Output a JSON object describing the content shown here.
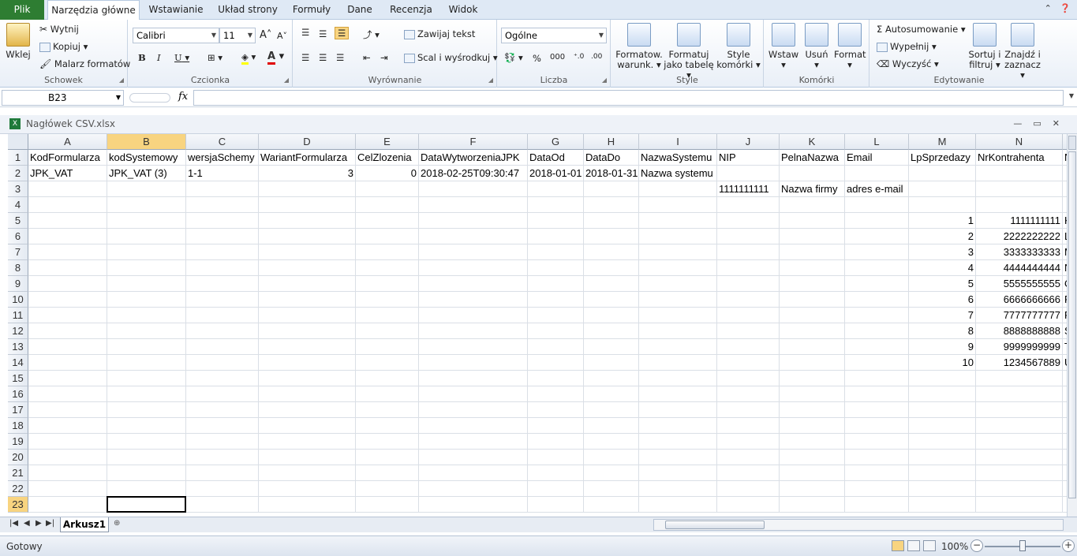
{
  "tabs": {
    "file": "Plik",
    "items": [
      "Narzędzia główne",
      "Wstawianie",
      "Układ strony",
      "Formuły",
      "Dane",
      "Recenzja",
      "Widok"
    ],
    "active_index": 0
  },
  "ribbon": {
    "clipboard": {
      "label": "Schowek",
      "paste": "Wklej",
      "cut": "Wytnij",
      "copy": "Kopiuj",
      "format_painter": "Malarz formatów"
    },
    "font": {
      "label": "Czcionka",
      "name": "Calibri",
      "size": "11",
      "bold": "B",
      "italic": "I",
      "underline": "U",
      "grow": "A",
      "shrink": "A"
    },
    "alignment": {
      "label": "Wyrównanie",
      "wrap": "Zawijaj tekst",
      "merge": "Scal i wyśrodkuj"
    },
    "number": {
      "label": "Liczba",
      "format": "Ogólne",
      "percent": "%",
      "thousands": "000"
    },
    "styles": {
      "label": "Style",
      "conditional": "Formatow. warunk.",
      "as_table": "Formatuj jako tabelę",
      "cell_styles": "Style komórki"
    },
    "cells": {
      "label": "Komórki",
      "insert": "Wstaw",
      "delete": "Usuń",
      "format": "Format"
    },
    "editing": {
      "label": "Edytowanie",
      "autosum": "Autosumowanie",
      "fill": "Wypełnij",
      "clear": "Wyczyść",
      "sort": "Sortuj i filtruj",
      "find": "Znajdź i zaznacz"
    }
  },
  "formula_bar": {
    "name_box": "B23",
    "fx": "fx",
    "content": ""
  },
  "workbook": {
    "title": "Nagłówek CSV.xlsx"
  },
  "grid": {
    "columns": [
      "A",
      "B",
      "C",
      "D",
      "E",
      "F",
      "G",
      "H",
      "I",
      "J",
      "K",
      "L",
      "M",
      "N"
    ],
    "rows": [
      "1",
      "2",
      "3",
      "4",
      "5",
      "6",
      "7",
      "8",
      "9",
      "10",
      "11",
      "12",
      "13",
      "14",
      "15",
      "16",
      "17",
      "18",
      "19",
      "20",
      "21",
      "22",
      "23"
    ],
    "selected_row": "23",
    "selected_column": "B",
    "cells": {
      "r1": [
        "KodFormularza",
        "kodSystemowy",
        "wersjaSchemy",
        "WariantFormularza",
        "CelZlozenia",
        "DataWytworzeniaJPK",
        "DataOd",
        "DataDo",
        "NazwaSystemu",
        "NIP",
        "PelnaNazwa",
        "Email",
        "LpSprzedazy",
        "NrKontrahenta"
      ],
      "r1_extra": "N",
      "r2": [
        "JPK_VAT",
        "JPK_VAT (3)",
        "1-1",
        "3",
        "0",
        "2018-02-25T09:30:47",
        "2018-01-01",
        "2018-01-31",
        "Nazwa systemu",
        "",
        "",
        "",
        "",
        ""
      ],
      "r3": [
        "",
        "",
        "",
        "",
        "",
        "",
        "",
        "",
        "",
        "1111111111",
        "Nazwa firmy",
        "adres e-mail",
        "",
        ""
      ],
      "lp": [
        "1",
        "2",
        "3",
        "4",
        "5",
        "6",
        "7",
        "8",
        "9",
        "10"
      ],
      "nr": [
        "1111111111",
        "2222222222",
        "3333333333",
        "4444444444",
        "5555555555",
        "6666666666",
        "7777777777",
        "8888888888",
        "9999999999",
        "1234567889"
      ],
      "o_letters": [
        "K",
        "L",
        "M",
        "N",
        "O",
        "P",
        "R",
        "S",
        "T",
        "U"
      ]
    }
  },
  "sheets": {
    "active": "Arkusz1"
  },
  "status": {
    "text": "Gotowy",
    "zoom": "100%",
    "minus": "−",
    "plus": "+"
  }
}
